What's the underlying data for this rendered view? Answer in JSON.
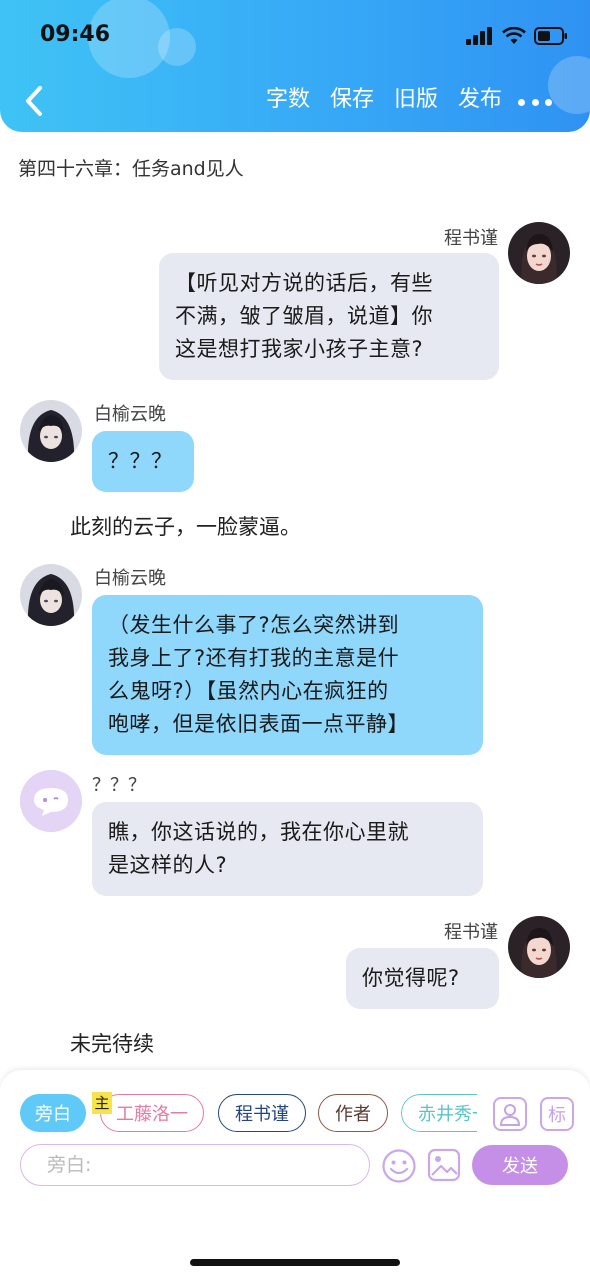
{
  "status_bar": {
    "time": "09:46"
  },
  "header": {
    "toolbar": [
      "字数",
      "保存",
      "旧版",
      "发布"
    ]
  },
  "chapter_title": "第四十六章：任务and见人",
  "messages": [
    {
      "speaker": "程书谨",
      "side": "right",
      "text": "【听见对方说的话后，有些不满，皱了皱眉，说道】你这是想打我家小孩子主意?",
      "lines": [
        "【听见对方说的话后，有些",
        "不满，皱了皱眉，说道】你",
        "这是想打我家小孩子主意?"
      ]
    },
    {
      "speaker": "白榆云晚",
      "side": "left",
      "text": "？？？"
    },
    {
      "narration": "此刻的云子，一脸蒙逼。"
    },
    {
      "speaker": "白榆云晚",
      "side": "left",
      "lines": [
        "（发生什么事了?怎么突然讲到",
        "我身上了?还有打我的主意是什",
        "么鬼呀?）【虽然内心在疯狂的",
        "咆哮，但是依旧表面一点平静】"
      ]
    },
    {
      "speaker": "？？？",
      "side": "left",
      "lines": [
        "瞧，你这话说的，我在你心里就",
        "是这样的人?"
      ]
    },
    {
      "speaker": "程书谨",
      "side": "right",
      "text": "你觉得呢?"
    },
    {
      "narration": "未完待续"
    }
  ],
  "bottom": {
    "chips": [
      "旁白",
      "工藤洛一",
      "程书谨",
      "作者",
      "赤井秀一"
    ],
    "main_badge": "主",
    "tag_icon_label": "标",
    "input_placeholder": "旁白:",
    "send_label": "发送"
  },
  "colors": {
    "header_gradient_start": "#3fc3f5",
    "header_gradient_end": "#2f92f3",
    "bubble_gray": "#e6e9f1",
    "bubble_blue": "#8fd7fb",
    "send_button": "#c58fe8"
  }
}
